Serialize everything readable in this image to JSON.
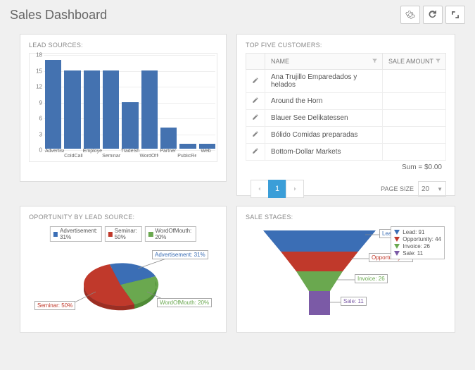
{
  "header": {
    "title": "Sales Dashboard"
  },
  "panels": {
    "lead_sources": "LEAD SOURCES:",
    "top_customers": "TOP FIVE CUSTOMERS:",
    "opportunity": "OPORTUNITY BY LEAD SOURCE:",
    "stages": "SALE STAGES:"
  },
  "table": {
    "col_name": "NAME",
    "col_amount": "SALE AMOUNT",
    "rows": [
      "Ana Trujillo Emparedados y helados",
      "Around the Horn",
      "Blauer See Delikatessen",
      "Bólido Comidas preparadas",
      "Bottom-Dollar Markets"
    ],
    "sum": "Sum = $0.00"
  },
  "pager": {
    "current": "1",
    "label": "PAGE SIZE",
    "size": "20"
  },
  "pie": {
    "legend": {
      "adv": "Advertisement: 31%",
      "sem": "Seminar: 50%",
      "wom": "WordOfMouth: 20%"
    },
    "callouts": {
      "adv": "Advertisement: 31%",
      "sem": "Seminar: 50%",
      "wom": "WordOfMouth: 20%"
    }
  },
  "funnel": {
    "legend": {
      "lead": "Lead: 91",
      "opp": "Opportunity: 44",
      "inv": "Invoice: 26",
      "sale": "Sale: 11"
    },
    "callouts": {
      "lead": "Lead: 91",
      "opp": "Opportunity: 44",
      "inv": "Invoice: 26",
      "sale": "Sale: 11"
    }
  },
  "colors": {
    "blue": "#3b6eb5",
    "red": "#c0392b",
    "green": "#6aa84f",
    "purple": "#7b5aa6"
  },
  "chart_data": [
    {
      "type": "bar",
      "title": "Lead Sources",
      "ylim": [
        0,
        18
      ],
      "yticks": [
        0,
        3,
        6,
        9,
        12,
        15,
        18
      ],
      "categories": [
        "Advertisement",
        "ColdCall",
        "EmployeeReferral",
        "Seminar",
        "TradeShow",
        "WordOfMouth",
        "Partner",
        "PublicRelations",
        "Web"
      ],
      "values": [
        17,
        15,
        15,
        15,
        9,
        15,
        4,
        1,
        1
      ]
    },
    {
      "type": "pie",
      "title": "Opportunity by Lead Source",
      "series": [
        {
          "name": "Advertisement",
          "value": 31,
          "color": "#3b6eb5"
        },
        {
          "name": "Seminar",
          "value": 50,
          "color": "#c0392b"
        },
        {
          "name": "WordOfMouth",
          "value": 20,
          "color": "#6aa84f"
        }
      ]
    },
    {
      "type": "funnel",
      "title": "Sale Stages",
      "series": [
        {
          "name": "Lead",
          "value": 91,
          "color": "#3b6eb5"
        },
        {
          "name": "Opportunity",
          "value": 44,
          "color": "#c0392b"
        },
        {
          "name": "Invoice",
          "value": 26,
          "color": "#6aa84f"
        },
        {
          "name": "Sale",
          "value": 11,
          "color": "#7b5aa6"
        }
      ]
    }
  ]
}
